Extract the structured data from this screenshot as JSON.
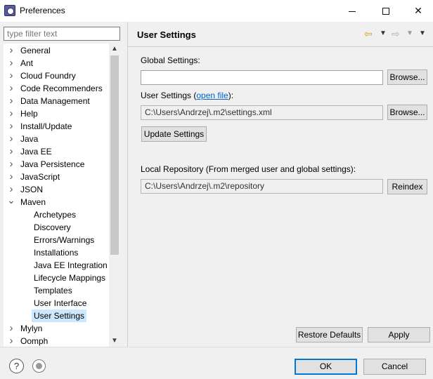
{
  "window": {
    "title": "Preferences"
  },
  "filter": {
    "placeholder": "type filter text"
  },
  "tree": {
    "items": [
      {
        "label": "General",
        "expanded": false
      },
      {
        "label": "Ant",
        "expanded": false
      },
      {
        "label": "Cloud Foundry",
        "expanded": false
      },
      {
        "label": "Code Recommenders",
        "expanded": false
      },
      {
        "label": "Data Management",
        "expanded": false
      },
      {
        "label": "Help",
        "expanded": false
      },
      {
        "label": "Install/Update",
        "expanded": false
      },
      {
        "label": "Java",
        "expanded": false
      },
      {
        "label": "Java EE",
        "expanded": false
      },
      {
        "label": "Java Persistence",
        "expanded": false
      },
      {
        "label": "JavaScript",
        "expanded": false
      },
      {
        "label": "JSON",
        "expanded": false
      },
      {
        "label": "Maven",
        "expanded": true
      },
      {
        "label": "Archetypes",
        "child": true
      },
      {
        "label": "Discovery",
        "child": true
      },
      {
        "label": "Errors/Warnings",
        "child": true
      },
      {
        "label": "Installations",
        "child": true
      },
      {
        "label": "Java EE Integration",
        "child": true
      },
      {
        "label": "Lifecycle Mappings",
        "child": true
      },
      {
        "label": "Templates",
        "child": true
      },
      {
        "label": "User Interface",
        "child": true
      },
      {
        "label": "User Settings",
        "child": true,
        "selected": true
      },
      {
        "label": "Mylyn",
        "expanded": false
      },
      {
        "label": "Oomph",
        "expanded": false
      }
    ]
  },
  "page": {
    "title": "User Settings",
    "global_label": "Global Settings:",
    "global_value": "",
    "browse1": "Browse...",
    "user_label_prefix": "User Settings (",
    "user_link": "open file",
    "user_label_suffix": "):",
    "user_value": "C:\\Users\\Andrzej\\.m2\\settings.xml",
    "browse2": "Browse...",
    "update_btn": "Update Settings",
    "local_label": "Local Repository (From merged user and global settings):",
    "local_value": "C:\\Users\\Andrzej\\.m2\\repository",
    "reindex_btn": "Reindex",
    "restore_btn": "Restore Defaults",
    "apply_btn": "Apply"
  },
  "footer": {
    "ok": "OK",
    "cancel": "Cancel"
  },
  "icons": {
    "help": "help-icon",
    "prefs": "import-export-icon"
  },
  "colors": {
    "selection": "#cce8ff",
    "link": "#0066cc",
    "accent": "#0078d7"
  }
}
